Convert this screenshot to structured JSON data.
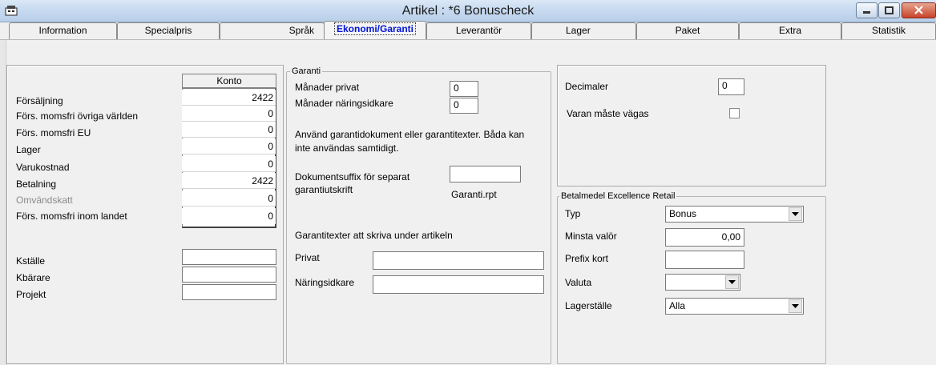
{
  "window": {
    "title": "Artikel : *6 Bonuscheck",
    "icon": "app-icon"
  },
  "tabs": [
    {
      "label": "Information"
    },
    {
      "label": "Specialpris"
    },
    {
      "label": "Språk"
    },
    {
      "label": "Ekonomi/Garanti",
      "active": true
    },
    {
      "label": "Leverantör"
    },
    {
      "label": "Lager"
    },
    {
      "label": "Paket"
    },
    {
      "label": "Extra"
    },
    {
      "label": "Statistik"
    }
  ],
  "accounts": {
    "column_header": "Konto",
    "rows": [
      {
        "label": "Försäljning",
        "value": "2422"
      },
      {
        "label": "Förs. momsfri övriga världen",
        "value": "0"
      },
      {
        "label": "Förs. momsfri EU",
        "value": "0"
      },
      {
        "label": "Lager",
        "value": "0"
      },
      {
        "label": "Varukostnad",
        "value": "0"
      },
      {
        "label": "Betalning",
        "value": "2422"
      },
      {
        "label": "Omvändskatt",
        "value": "0"
      },
      {
        "label": "Förs. momsfri inom landet",
        "value": "0"
      }
    ],
    "dims": [
      {
        "label": "Kställe",
        "value": ""
      },
      {
        "label": "Kbärare",
        "value": ""
      },
      {
        "label": "Projekt",
        "value": ""
      }
    ]
  },
  "garanti": {
    "legend": "Garanti",
    "months_private_label": "Månader privat",
    "months_private_value": "0",
    "months_business_label": "Månader näringsidkare",
    "months_business_value": "0",
    "info_line1": "Använd garantidokument eller garantitexter. Båda kan",
    "info_line2": "inte användas samtidigt.",
    "suffix_label_line1": "Dokumentsuffix för separat",
    "suffix_label_line2": "garantiutskrift",
    "suffix_value": "",
    "report_name": "Garanti.rpt",
    "texts_heading": "Garantitexter att skriva under artikeln",
    "private_label": "Privat",
    "private_value": "",
    "business_label": "Näringsidkare",
    "business_value": ""
  },
  "misc": {
    "decimals_label": "Decimaler",
    "decimals_value": "0",
    "weigh_label": "Varan måste vägas",
    "weigh_checked": false
  },
  "payment": {
    "legend": "Betalmedel Excellence Retail",
    "type_label": "Typ",
    "type_value": "Bonus",
    "min_label": "Minsta valör",
    "min_value": "0,00",
    "prefix_label": "Prefix kort",
    "prefix_value": "",
    "currency_label": "Valuta",
    "currency_value": "",
    "store_label": "Lagerställe",
    "store_value": "Alla"
  }
}
